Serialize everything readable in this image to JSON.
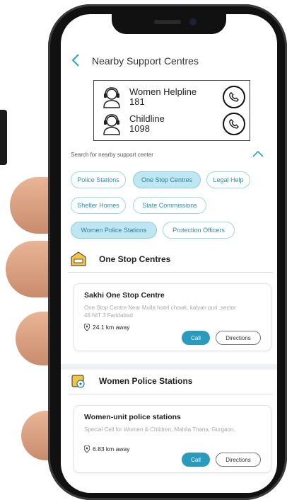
{
  "header": {
    "title": "Nearby Support Centres"
  },
  "helplines": [
    {
      "name": "Women Helpline",
      "number": "181"
    },
    {
      "name": "Childline",
      "number": "1098"
    }
  ],
  "search": {
    "label": "Search for nearby support center"
  },
  "filters": {
    "row1": [
      "Police Stations",
      "One Stop Centres",
      "Legal Help"
    ],
    "row2": [
      "Shelter Homes",
      "State Commissions"
    ],
    "row3": [
      "Women Police Stations",
      "Protection Officers"
    ],
    "active": [
      "One Stop Centres",
      "Women Police Stations"
    ]
  },
  "sections": [
    {
      "title": "One Stop Centres",
      "card": {
        "name": "Sakhi One Stop Centre",
        "address": "One Stop Centre Near Mulla hotel chowk, kalyan puri ,sector 48 NIT 3 Faridabad",
        "distance": "24.1 km away",
        "call_label": "Call",
        "directions_label": "Directions"
      }
    },
    {
      "title": "Women Police Stations",
      "card": {
        "name": "Women-unit police stations",
        "address": "Special Cell for Women & Children, Mahila Thana, Gurgaon.",
        "distance": "6.83 km away",
        "call_label": "Call",
        "directions_label": "Directions"
      }
    }
  ],
  "colors": {
    "accent": "#2b9bbd",
    "chip_active": "#bfe7f1"
  }
}
